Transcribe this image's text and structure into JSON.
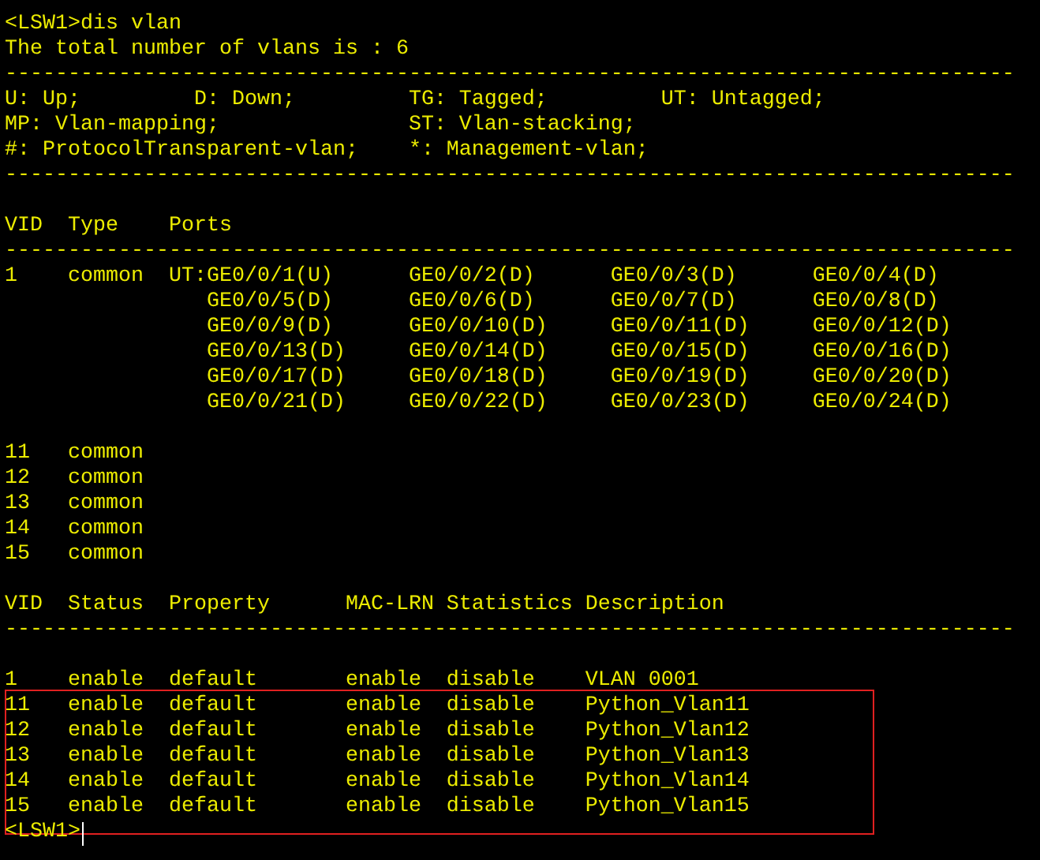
{
  "lines": [
    {
      "kind": "text",
      "text": "<LSW1>dis vlan",
      "highlighted": false
    },
    {
      "kind": "text",
      "text": "The total number of vlans is : 6",
      "highlighted": false
    },
    {
      "kind": "text",
      "text": "--------------------------------------------------------------------------------",
      "highlighted": false
    },
    {
      "kind": "text",
      "text": "U: Up;         D: Down;         TG: Tagged;         UT: Untagged;",
      "highlighted": false
    },
    {
      "kind": "text",
      "text": "MP: Vlan-mapping;               ST: Vlan-stacking;",
      "highlighted": false
    },
    {
      "kind": "text",
      "text": "#: ProtocolTransparent-vlan;    *: Management-vlan;",
      "highlighted": false
    },
    {
      "kind": "text",
      "text": "--------------------------------------------------------------------------------",
      "highlighted": false
    },
    {
      "kind": "blank",
      "highlighted": false
    },
    {
      "kind": "text",
      "text": "VID  Type    Ports",
      "highlighted": false
    },
    {
      "kind": "text",
      "text": "--------------------------------------------------------------------------------",
      "highlighted": false
    },
    {
      "kind": "text",
      "text": "1    common  UT:GE0/0/1(U)      GE0/0/2(D)      GE0/0/3(D)      GE0/0/4(D)",
      "highlighted": false
    },
    {
      "kind": "text",
      "text": "                GE0/0/5(D)      GE0/0/6(D)      GE0/0/7(D)      GE0/0/8(D)",
      "highlighted": false
    },
    {
      "kind": "text",
      "text": "                GE0/0/9(D)      GE0/0/10(D)     GE0/0/11(D)     GE0/0/12(D)",
      "highlighted": false
    },
    {
      "kind": "text",
      "text": "                GE0/0/13(D)     GE0/0/14(D)     GE0/0/15(D)     GE0/0/16(D)",
      "highlighted": false
    },
    {
      "kind": "text",
      "text": "                GE0/0/17(D)     GE0/0/18(D)     GE0/0/19(D)     GE0/0/20(D)",
      "highlighted": false
    },
    {
      "kind": "text",
      "text": "                GE0/0/21(D)     GE0/0/22(D)     GE0/0/23(D)     GE0/0/24(D)",
      "highlighted": false
    },
    {
      "kind": "blank",
      "highlighted": false
    },
    {
      "kind": "text",
      "text": "11   common",
      "highlighted": false
    },
    {
      "kind": "text",
      "text": "12   common",
      "highlighted": false
    },
    {
      "kind": "text",
      "text": "13   common",
      "highlighted": false
    },
    {
      "kind": "text",
      "text": "14   common",
      "highlighted": false
    },
    {
      "kind": "text",
      "text": "15   common",
      "highlighted": false
    },
    {
      "kind": "blank",
      "highlighted": false
    },
    {
      "kind": "text",
      "text": "VID  Status  Property      MAC-LRN Statistics Description",
      "highlighted": false
    },
    {
      "kind": "text",
      "text": "--------------------------------------------------------------------------------",
      "highlighted": false
    },
    {
      "kind": "blank",
      "highlighted": false
    },
    {
      "kind": "text",
      "text": "1    enable  default       enable  disable    VLAN 0001",
      "highlighted": false
    },
    {
      "kind": "text",
      "text": "11   enable  default       enable  disable    Python_Vlan11",
      "highlighted": true
    },
    {
      "kind": "text",
      "text": "12   enable  default       enable  disable    Python_Vlan12",
      "highlighted": true
    },
    {
      "kind": "text",
      "text": "13   enable  default       enable  disable    Python_Vlan13",
      "highlighted": true
    },
    {
      "kind": "text",
      "text": "14   enable  default       enable  disable    Python_Vlan14",
      "highlighted": true
    },
    {
      "kind": "text",
      "text": "15   enable  default       enable  disable    Python_Vlan15",
      "highlighted": true
    },
    {
      "kind": "prompt",
      "text": "<LSW1>",
      "highlighted": false
    }
  ]
}
